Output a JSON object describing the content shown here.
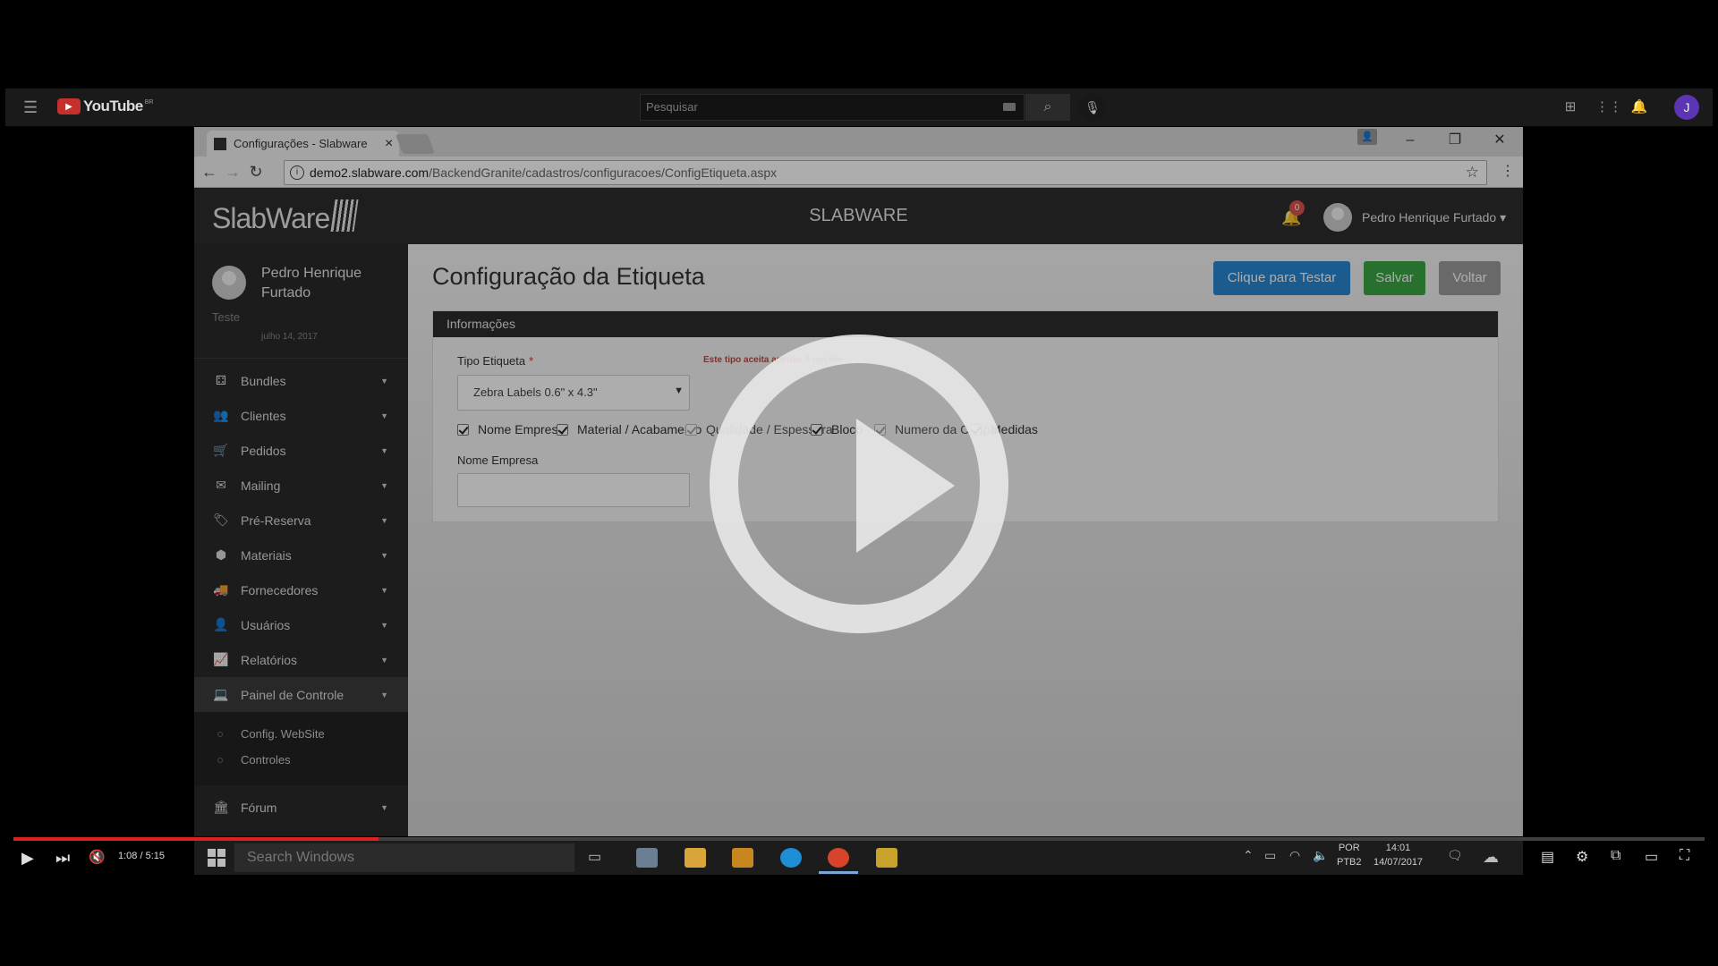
{
  "youtube": {
    "logo_text": "YouTube",
    "logo_region": "BR",
    "search_placeholder": "Pesquisar",
    "avatar_letter": "J"
  },
  "browser": {
    "tab_title": "Configurações - Slabware",
    "url_host": "demo2.slabware.com",
    "url_path": "/BackendGranite/cadastros/configuracoes/ConfigEtiqueta.aspx"
  },
  "app": {
    "logo": "SlabWare",
    "title": "SLABWARE",
    "notifications_count": "0",
    "user_name": "Pedro Henrique Furtado"
  },
  "sidebar": {
    "user_name": "Pedro Henrique Furtado",
    "role": "Teste",
    "date": "julho 14, 2017",
    "items": [
      {
        "label": "Bundles",
        "icon": "cubes-icon"
      },
      {
        "label": "Clientes",
        "icon": "users-icon"
      },
      {
        "label": "Pedidos",
        "icon": "cart-icon"
      },
      {
        "label": "Mailing",
        "icon": "envelope-icon"
      },
      {
        "label": "Pré-Reserva",
        "icon": "tag-icon"
      },
      {
        "label": "Materiais",
        "icon": "cube-icon"
      },
      {
        "label": "Fornecedores",
        "icon": "truck-icon"
      },
      {
        "label": "Usuários",
        "icon": "user-icon"
      },
      {
        "label": "Relatórios",
        "icon": "chart-icon"
      },
      {
        "label": "Painel de Controle",
        "icon": "laptop-icon"
      },
      {
        "label": "Fórum",
        "icon": "institution-icon"
      }
    ],
    "subitems": [
      "Config. WebSite",
      "Controles"
    ]
  },
  "page": {
    "title": "Configuração da Etiqueta",
    "btn_test": "Clique para Testar",
    "btn_save": "Salvar",
    "btn_back": "Voltar"
  },
  "panel": {
    "header": "Informações",
    "tipo_label": "Tipo Etiqueta",
    "required_mark": "*",
    "tipo_hint": "Este tipo aceita apenas 5 opções",
    "tipo_value": "Zebra Labels 0.6\" x 4.3\"",
    "checkboxes": [
      {
        "label": "Nome Empresa",
        "checked": true
      },
      {
        "label": "Material / Acabamento",
        "checked": true
      },
      {
        "label": "Qualidade / Espessura",
        "checked": true
      },
      {
        "label": "Bloco",
        "checked": true
      },
      {
        "label": "Numero da Chapa",
        "checked": true
      },
      {
        "label": "Medidas",
        "checked": true
      }
    ],
    "nome_label": "Nome Empresa",
    "nome_value": ""
  },
  "player": {
    "time": "1:08 / 5:15",
    "progress": 0.216
  },
  "taskbar": {
    "search_placeholder": "Search Windows",
    "lang_1": "POR",
    "lang_2": "PTB2",
    "time": "14:01",
    "date": "14/07/2017"
  }
}
